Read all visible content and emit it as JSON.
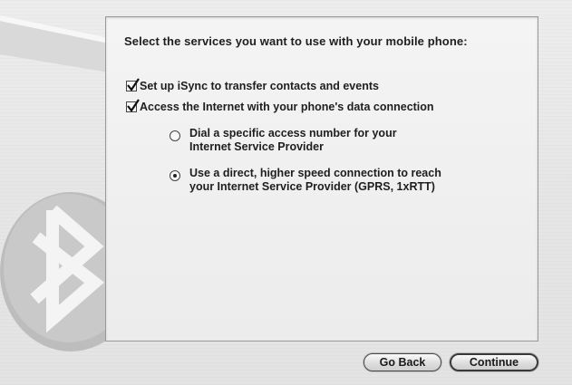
{
  "panel": {
    "heading": "Select the services you want to use with your mobile phone:"
  },
  "options": {
    "isync": {
      "label": "Set up iSync to transfer contacts and events",
      "checked": true
    },
    "internet": {
      "label": "Access the Internet with your phone's data connection",
      "checked": true
    },
    "dial": {
      "line1": "Dial a specific access number for your",
      "line2": "Internet Service Provider",
      "selected": false
    },
    "direct": {
      "line1": "Use a direct, higher speed connection to reach",
      "line2": "your Internet Service Provider (GPRS, 1xRTT)",
      "selected": true
    }
  },
  "buttons": {
    "back": "Go Back",
    "continue": "Continue"
  },
  "icons": {
    "brand": "bluetooth-icon",
    "brand_color": "#c8c8c8"
  }
}
